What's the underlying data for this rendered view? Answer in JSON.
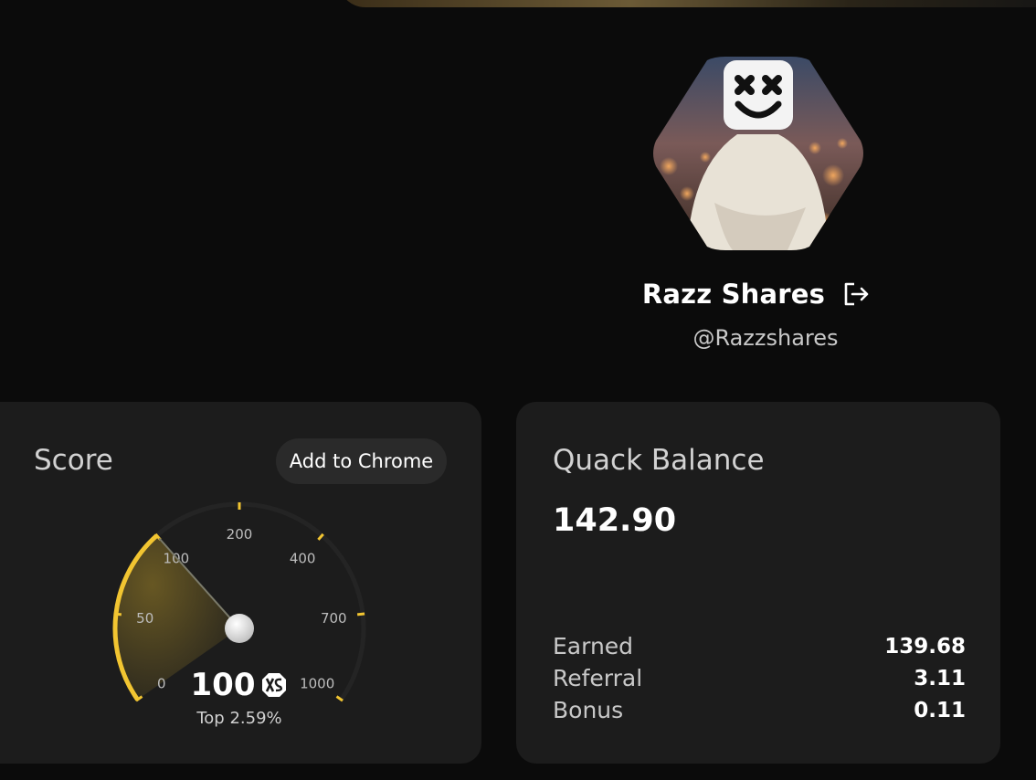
{
  "profile": {
    "name": "Razz Shares",
    "handle": "@Razzshares",
    "avatar_icon": "marshmello-avatar",
    "logout_icon": "logout-icon"
  },
  "score_card": {
    "title": "Score",
    "add_button": "Add to Chrome",
    "value": "100",
    "rank_text": "Top 2.59%",
    "badge_icon": "xs-logo-icon",
    "accent_color": "#f2c531",
    "gauge": {
      "ticks": [
        "0",
        "50",
        "100",
        "200",
        "400",
        "700",
        "1000"
      ],
      "current": 100,
      "min": 0,
      "max": 1000
    }
  },
  "balance_card": {
    "title": "Quack Balance",
    "value": "142.90",
    "rows": [
      {
        "label": "Earned",
        "value": "139.68"
      },
      {
        "label": "Referral",
        "value": "3.11"
      },
      {
        "label": "Bonus",
        "value": "0.11"
      }
    ]
  }
}
